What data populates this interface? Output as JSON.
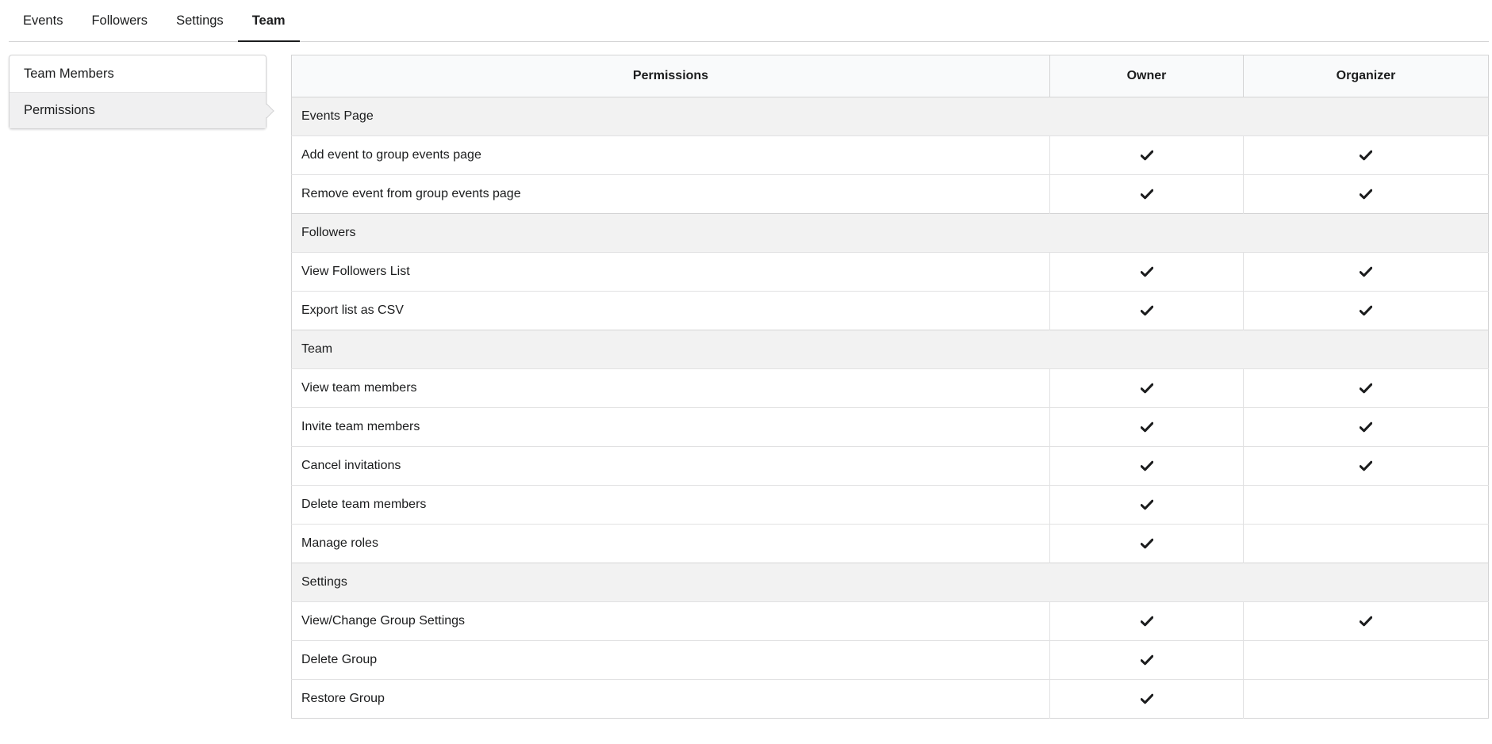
{
  "tabs": [
    {
      "label": "Events",
      "active": false
    },
    {
      "label": "Followers",
      "active": false
    },
    {
      "label": "Settings",
      "active": false
    },
    {
      "label": "Team",
      "active": true
    }
  ],
  "side_menu": [
    {
      "label": "Team Members",
      "active": false
    },
    {
      "label": "Permissions",
      "active": true
    }
  ],
  "table": {
    "headers": [
      "Permissions",
      "Owner",
      "Organizer"
    ],
    "rows": [
      {
        "type": "section",
        "label": "Events Page"
      },
      {
        "type": "perm",
        "label": "Add event to group events page",
        "owner": true,
        "organizer": true
      },
      {
        "type": "perm",
        "label": "Remove event from group events page",
        "owner": true,
        "organizer": true
      },
      {
        "type": "section",
        "label": "Followers"
      },
      {
        "type": "perm",
        "label": "View Followers List",
        "owner": true,
        "organizer": true
      },
      {
        "type": "perm",
        "label": "Export list as CSV",
        "owner": true,
        "organizer": true
      },
      {
        "type": "section",
        "label": "Team"
      },
      {
        "type": "perm",
        "label": "View team members",
        "owner": true,
        "organizer": true
      },
      {
        "type": "perm",
        "label": "Invite team members",
        "owner": true,
        "organizer": true
      },
      {
        "type": "perm",
        "label": "Cancel invitations",
        "owner": true,
        "organizer": true
      },
      {
        "type": "perm",
        "label": "Delete team members",
        "owner": true,
        "organizer": false
      },
      {
        "type": "perm",
        "label": "Manage roles",
        "owner": true,
        "organizer": false
      },
      {
        "type": "section",
        "label": "Settings"
      },
      {
        "type": "perm",
        "label": "View/Change Group Settings",
        "owner": true,
        "organizer": true
      },
      {
        "type": "perm",
        "label": "Delete Group",
        "owner": true,
        "organizer": false
      },
      {
        "type": "perm",
        "label": "Restore Group",
        "owner": true,
        "organizer": false
      }
    ]
  },
  "icons": {
    "check": "checkmark-icon"
  }
}
